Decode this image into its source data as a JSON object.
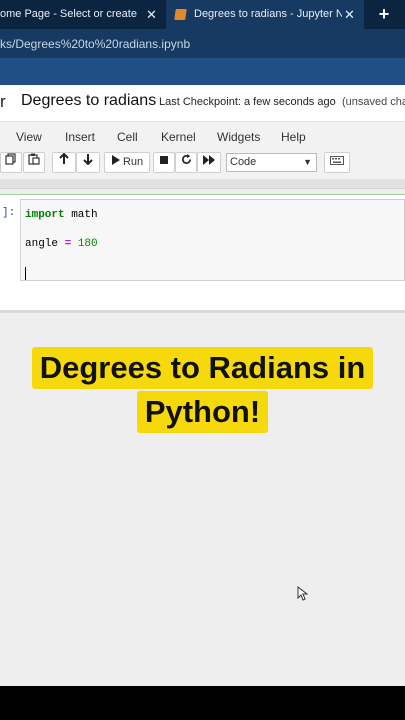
{
  "browser": {
    "tabs": [
      {
        "label": "ome Page - Select or create a n",
        "close": "✕"
      },
      {
        "label": "Degrees to radians - Jupyter Not",
        "close": "✕"
      }
    ],
    "new_tab": "+",
    "url": "ks/Degrees%20to%20radians.ipynb"
  },
  "header": {
    "logo_fragment": "r",
    "notebook_title": "Degrees to radians",
    "checkpoint": "Last Checkpoint: a few seconds ago",
    "unsaved": "(unsaved cha"
  },
  "menu": {
    "items": [
      "View",
      "Insert",
      "Cell",
      "Kernel",
      "Widgets",
      "Help"
    ]
  },
  "toolbar": {
    "run_label": "Run",
    "cell_type": "Code"
  },
  "cell": {
    "prompt": "]:",
    "line1_keyword": "import",
    "line1_rest": " math",
    "line2_var": "angle ",
    "line2_op": "=",
    "line2_value": " 180"
  },
  "overlay": {
    "line1": "Degrees to Radians in",
    "line2": "Python!"
  },
  "colors": {
    "overlay_bg": "#f5d90a",
    "tabbar": "#0b2540",
    "urlbar": "#163a61"
  }
}
